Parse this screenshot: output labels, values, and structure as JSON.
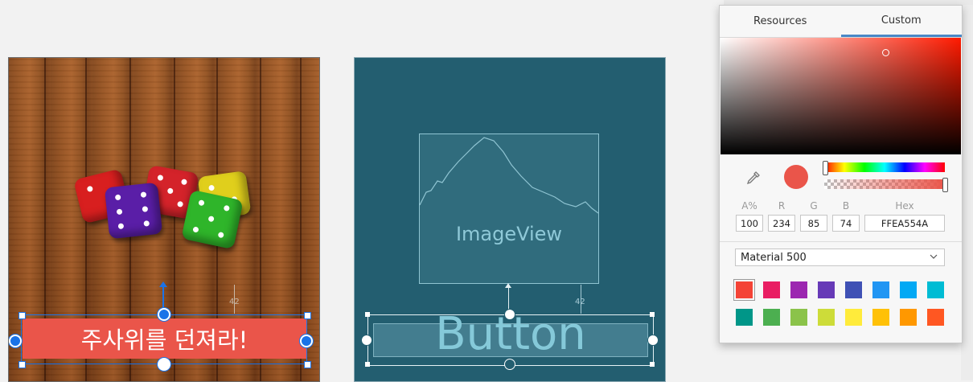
{
  "picker": {
    "tabs": [
      {
        "label": "Resources",
        "active": false
      },
      {
        "label": "Custom",
        "active": true
      }
    ],
    "current_color": "#ea554a",
    "fields": {
      "alpha_label": "A%",
      "alpha": "100",
      "r_label": "R",
      "r": "234",
      "g_label": "G",
      "g": "85",
      "b_label": "B",
      "b": "74",
      "hex_label": "Hex",
      "hex": "FFEA554A"
    },
    "palette": "Material 500",
    "swatches": [
      "#f44336",
      "#e91e63",
      "#9c27b0",
      "#673ab7",
      "#3f51b5",
      "#2196f3",
      "#03a9f4",
      "#00bcd4",
      "#009688",
      "#4caf50",
      "#8bc34a",
      "#cddc39",
      "#ffeb3b",
      "#ffc107",
      "#ff9800",
      "#ff5722"
    ],
    "selected_swatch": 0
  },
  "design": {
    "button_text": "주사위를 던져라!",
    "margin_label": "42"
  },
  "blueprint": {
    "imageview_label": "ImageView",
    "button_label": "Button",
    "margin_label": "42"
  }
}
